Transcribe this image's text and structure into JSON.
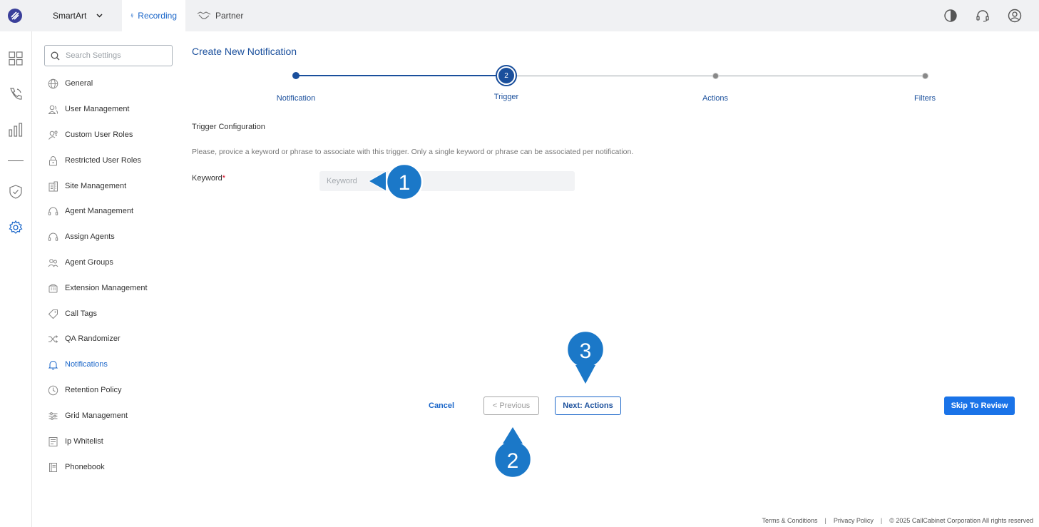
{
  "topbar": {
    "app_name": "SmartArt",
    "tabs": [
      {
        "label": "Recording",
        "icon": "microphone-icon",
        "active": true
      },
      {
        "label": "Partner",
        "icon": "handshake-icon",
        "active": false
      }
    ],
    "right_icons": [
      "contrast-icon",
      "headset-icon",
      "user-icon"
    ]
  },
  "rail": {
    "icons": [
      "dashboard-icon",
      "phone-icon",
      "bar-chart-icon",
      "shield-icon",
      "settings-icon"
    ]
  },
  "sidebar": {
    "search_placeholder": "Search Settings",
    "items": [
      {
        "label": "General",
        "icon": "globe-icon"
      },
      {
        "label": "User Management",
        "icon": "users-icon"
      },
      {
        "label": "Custom User Roles",
        "icon": "user-key-icon"
      },
      {
        "label": "Restricted User Roles",
        "icon": "lock-icon"
      },
      {
        "label": "Site Management",
        "icon": "building-icon"
      },
      {
        "label": "Agent Management",
        "icon": "headset-icon"
      },
      {
        "label": "Assign Agents",
        "icon": "headset-icon"
      },
      {
        "label": "Agent Groups",
        "icon": "group-icon"
      },
      {
        "label": "Extension Management",
        "icon": "phone-ext-icon"
      },
      {
        "label": "Call Tags",
        "icon": "tag-icon"
      },
      {
        "label": "QA Randomizer",
        "icon": "shuffle-icon"
      },
      {
        "label": "Notifications",
        "icon": "bell-icon",
        "active": true
      },
      {
        "label": "Retention Policy",
        "icon": "clock-icon"
      },
      {
        "label": "Grid Management",
        "icon": "sliders-icon"
      },
      {
        "label": "Ip Whitelist",
        "icon": "list-icon"
      },
      {
        "label": "Phonebook",
        "icon": "book-icon"
      }
    ]
  },
  "main": {
    "title": "Create New Notification",
    "steps": [
      {
        "label": "Notification",
        "state": "done"
      },
      {
        "label": "Trigger",
        "state": "current",
        "number": "2"
      },
      {
        "label": "Actions",
        "state": "pending"
      },
      {
        "label": "Filters",
        "state": "pending"
      }
    ],
    "section_title": "Trigger Configuration",
    "section_desc": "Please, provice a keyword or phrase to associate with this trigger. Only a single keyword or phrase can be associated per notification.",
    "keyword_label": "Keyword",
    "keyword_required": "*",
    "keyword_placeholder": "Keyword",
    "keyword_value": "",
    "buttons": {
      "cancel": "Cancel",
      "previous": "< Previous",
      "next": "Next: Actions",
      "skip": "Skip To Review"
    }
  },
  "callouts": [
    "1",
    "2",
    "3"
  ],
  "footer": {
    "terms": "Terms & Conditions",
    "privacy": "Privacy Policy",
    "copyright": "© 2025 CallCabinet Corporation All rights reserved",
    "separator": "|"
  },
  "colors": {
    "accent": "#1a66c9",
    "primary_button": "#1a73e8",
    "callout": "#1b78c8",
    "step_done": "#1a4f9c"
  }
}
